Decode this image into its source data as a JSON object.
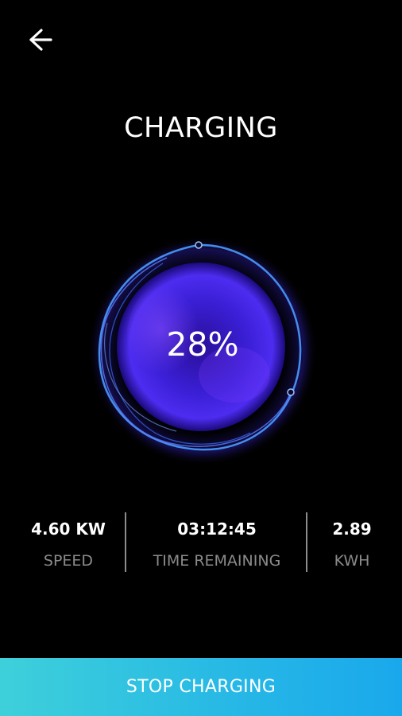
{
  "header": {
    "back_icon": "arrow-left-icon",
    "title": "CHARGING"
  },
  "charge": {
    "percent_label": "28%",
    "percent_value": 28,
    "orb_colors": {
      "core": "#3a1fd6",
      "glow": "#6a3cff",
      "ring": "#4a9cff"
    }
  },
  "stats": [
    {
      "value": "4.60 KW",
      "label": "SPEED"
    },
    {
      "value": "03:12:45",
      "label": "TIME REMAINING"
    },
    {
      "value": "2.89",
      "label": "KWH"
    }
  ],
  "footer": {
    "stop_label": "STOP CHARGING"
  },
  "colors": {
    "background": "#000000",
    "button_gradient_start": "#3ed0da",
    "button_gradient_end": "#1aa8ec",
    "label_gray": "#8a8a8a"
  }
}
